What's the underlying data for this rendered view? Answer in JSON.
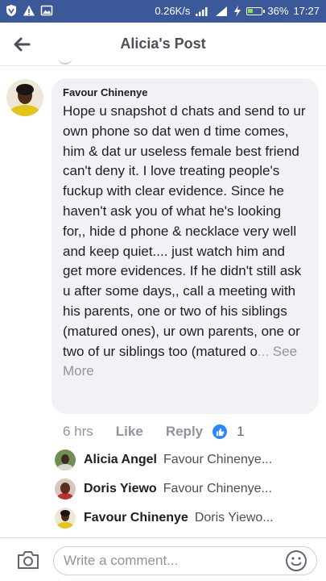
{
  "status_bar": {
    "speed": "0.26K/s",
    "battery": "36%",
    "time": "17:27",
    "icons": [
      "vpn-shield-icon",
      "warning-icon",
      "image-icon",
      "wifi-icon",
      "signal-icon",
      "signal-icon",
      "charging-bolt-icon",
      "battery-icon"
    ]
  },
  "header": {
    "title": "Alicia's Post",
    "back_icon": "back-arrow-icon"
  },
  "comment": {
    "author": "Favour Chinenye",
    "text_visible": "Hope u snapshot d chats and send to ur own phone so dat wen d time comes, him & dat ur useless female best friend can't deny it. I love treating people's fuckup with clear evidence.  Since he haven't ask you of what he's looking for,, hide d phone & necklace very well and keep quiet.... just watch him and get more evidences.    If he didn't still ask u after some days,, call a meeting with his parents, one or two of his siblings (matured ones), ur own parents, one or two of ur siblings too (matured o",
    "text_fade": "...",
    "see_more": " See More",
    "time": "6 hrs",
    "like_label": "Like",
    "reply_label": "Reply",
    "reaction_count": "1"
  },
  "replies": [
    {
      "name": "Alicia Angel",
      "text": "Favour Chinenye..."
    },
    {
      "name": "Doris Yiewo",
      "text": "Favour Chinenye..."
    },
    {
      "name": "Favour Chinenye",
      "text": "Doris Yiewo..."
    }
  ],
  "composer": {
    "placeholder": "Write a comment..."
  },
  "colors": {
    "status_bar": "#3b5999",
    "bubble": "#f1f2f6",
    "like_blue": "#2d88ff"
  }
}
